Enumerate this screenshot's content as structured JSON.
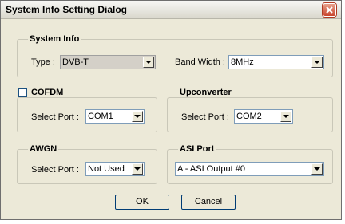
{
  "window": {
    "title": "System Info Setting Dialog"
  },
  "system_info": {
    "group_label": "System Info",
    "type_label": "Type :",
    "type_value": "DVB-T",
    "bandwidth_label": "Band Width :",
    "bandwidth_value": "8MHz"
  },
  "cofdm": {
    "group_label": "COFDM",
    "checked": false,
    "port_label": "Select Port :",
    "port_value": "COM1"
  },
  "upconverter": {
    "group_label": "Upconverter",
    "port_label": "Select Port :",
    "port_value": "COM2"
  },
  "awgn": {
    "group_label": "AWGN",
    "port_label": "Select Port :",
    "port_value": "Not Used"
  },
  "asi_port": {
    "group_label": "ASI Port",
    "value": "A - ASI Output #0"
  },
  "buttons": {
    "ok": "OK",
    "cancel": "Cancel"
  }
}
